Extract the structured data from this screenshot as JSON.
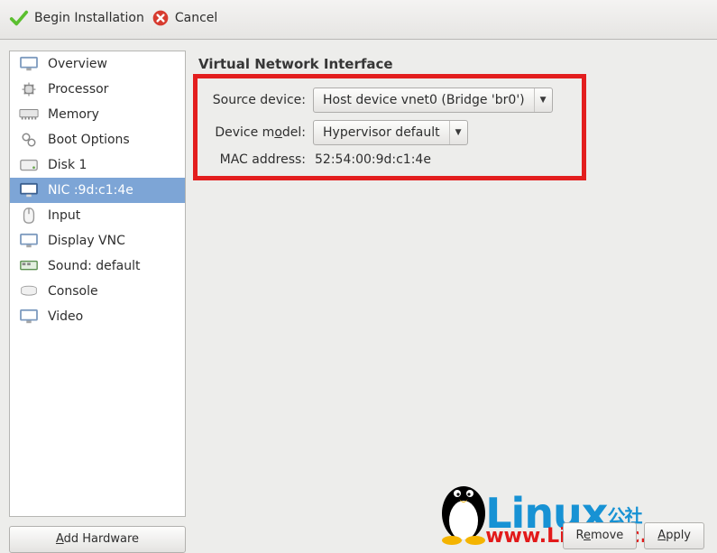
{
  "toolbar": {
    "begin_label": "Begin Installation",
    "cancel_label": "Cancel"
  },
  "sidebar": {
    "items": [
      {
        "label": "Overview"
      },
      {
        "label": "Processor"
      },
      {
        "label": "Memory"
      },
      {
        "label": "Boot Options"
      },
      {
        "label": "Disk 1"
      },
      {
        "label": "NIC :9d:c1:4e"
      },
      {
        "label": "Input"
      },
      {
        "label": "Display VNC"
      },
      {
        "label": "Sound: default"
      },
      {
        "label": "Console"
      },
      {
        "label": "Video"
      }
    ],
    "add_hardware_label": "Add Hardware"
  },
  "panel": {
    "title": "Virtual Network Interface",
    "labels": {
      "source": "Source device:",
      "model_prefix": "Device m",
      "model_underline": "o",
      "model_suffix": "del:",
      "mac": "MAC address:"
    },
    "source_value": "Host device vnet0 (Bridge 'br0')",
    "model_value": "Hypervisor default",
    "mac_value": "52:54:00:9d:c1:4e"
  },
  "footer": {
    "remove_prefix": "R",
    "remove_underline": "e",
    "remove_suffix": "move",
    "apply_label": "Apply"
  },
  "watermark": {
    "line1_main": "Linux",
    "line1_suffix": "公社",
    "line2": "www.Linuxidc.com"
  }
}
